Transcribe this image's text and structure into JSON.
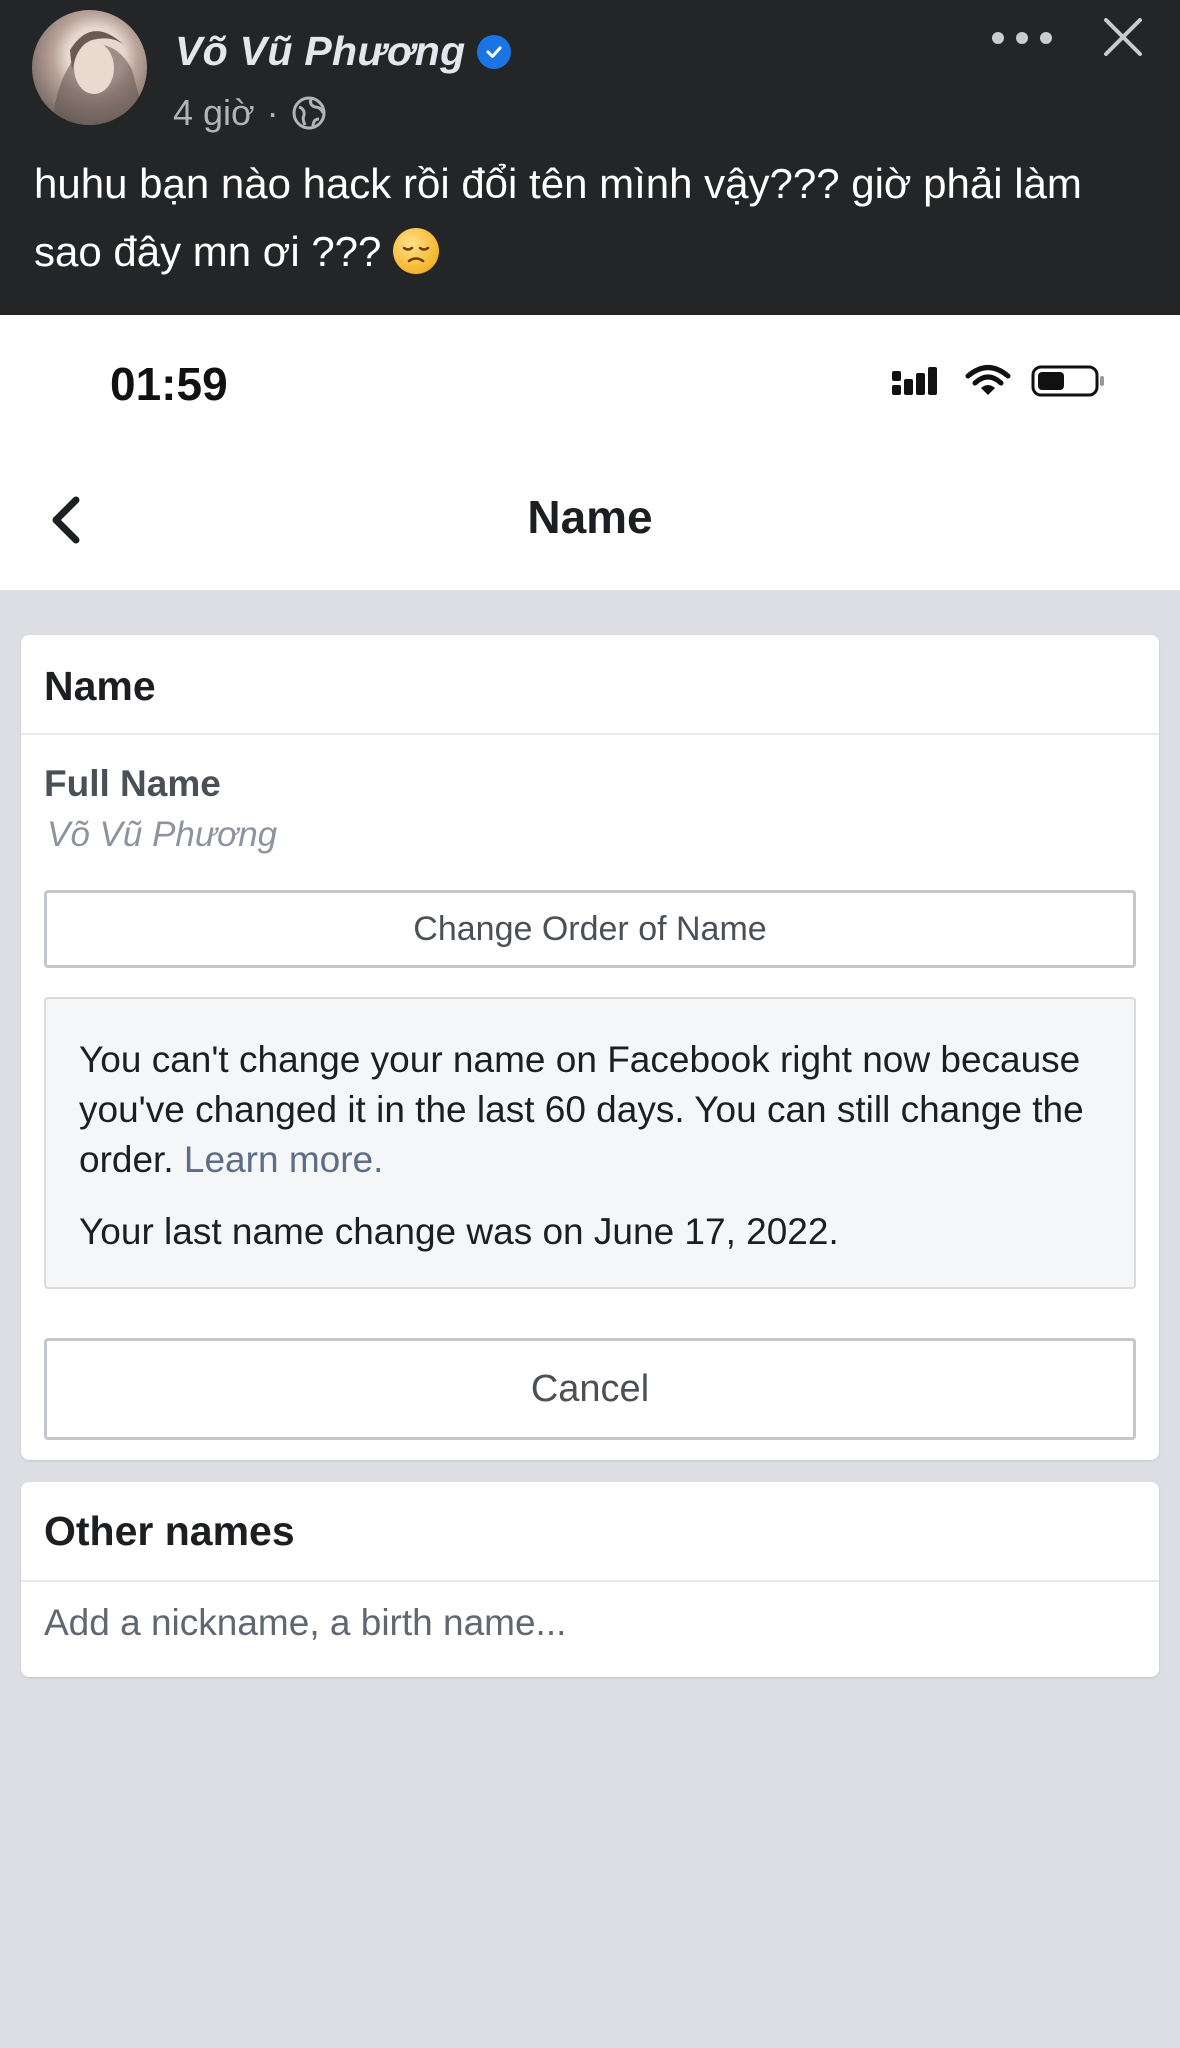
{
  "post": {
    "author": "Võ Vũ Phương",
    "time": "4 giờ",
    "separator": "·",
    "text": "huhu bạn nào hack rồi đổi tên mình vậy???  giờ phải làm sao đây mn ơi ???",
    "icons": {
      "verified": "verified-badge-icon",
      "privacy": "globe-icon",
      "more": "more-icon",
      "close": "close-icon",
      "emoji": "disappointed-face-icon"
    }
  },
  "phone": {
    "time": "01:59",
    "status_icons": [
      "signal-icon",
      "wifi-icon",
      "battery-icon"
    ]
  },
  "nav": {
    "title": "Name",
    "back_icon": "chevron-left-icon"
  },
  "name_section": {
    "title": "Name",
    "field_label": "Full Name",
    "field_value": "Võ Vũ Phương",
    "change_order_label": "Change Order of Name",
    "notice": {
      "text": "You can't change your name on Facebook right now because you've changed it in the last 60 days. You can still change the order.",
      "link": "Learn more.",
      "last_change": "Your last name change was on June 17, 2022."
    },
    "cancel_label": "Cancel"
  },
  "other_names": {
    "title": "Other names",
    "placeholder": "Add a nickname, a birth name..."
  },
  "colors": {
    "verified": "#1b74e4",
    "post_bg": "#242526",
    "page_bg": "#dddee3",
    "link": "#5d6d86"
  }
}
